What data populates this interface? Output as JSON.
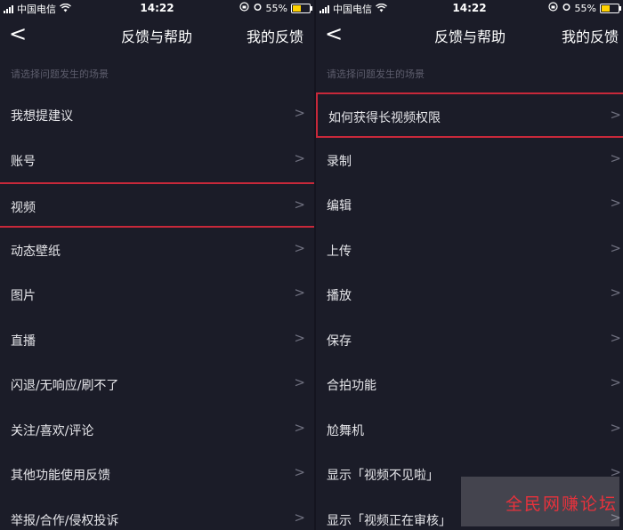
{
  "left": {
    "status": {
      "carrier": "中国电信",
      "time": "14:22",
      "battery": "55%",
      "battery_level": 0.55
    },
    "nav": {
      "back_glyph": "<",
      "title": "反馈与帮助",
      "action": "我的反馈"
    },
    "hint": "请选择问题发生的场景",
    "items": [
      {
        "label": "我想提建议"
      },
      {
        "label": "账号"
      },
      {
        "label": "视频",
        "highlighted": true
      },
      {
        "label": "动态壁纸"
      },
      {
        "label": "图片"
      },
      {
        "label": "直播"
      },
      {
        "label": "闪退/无响应/刷不了"
      },
      {
        "label": "关注/喜欢/评论"
      },
      {
        "label": "其他功能使用反馈"
      },
      {
        "label": "举报/合作/侵权投诉"
      }
    ]
  },
  "right": {
    "status": {
      "carrier": "中国电信",
      "time": "14:22",
      "battery": "55%",
      "battery_level": 0.55
    },
    "nav": {
      "back_glyph": "<",
      "title": "反馈与帮助",
      "action": "我的反馈"
    },
    "hint": "请选择问题发生的场景",
    "items": [
      {
        "label": "如何获得长视频权限",
        "highlighted": true
      },
      {
        "label": "录制"
      },
      {
        "label": "编辑"
      },
      {
        "label": "上传"
      },
      {
        "label": "播放"
      },
      {
        "label": "保存"
      },
      {
        "label": "合拍功能"
      },
      {
        "label": "尬舞机"
      },
      {
        "label": "显示「视频不见啦」"
      },
      {
        "label": "显示「视频正在审核」"
      }
    ]
  },
  "chevron_glyph": ">",
  "watermark": {
    "text": "全民网赚论坛"
  },
  "colors": {
    "background": "#1b1c28",
    "highlight_border": "#c8283a",
    "hint_text": "#5c5d6c",
    "battery_fill": "#ffd200",
    "watermark_text": "#e8323c"
  }
}
